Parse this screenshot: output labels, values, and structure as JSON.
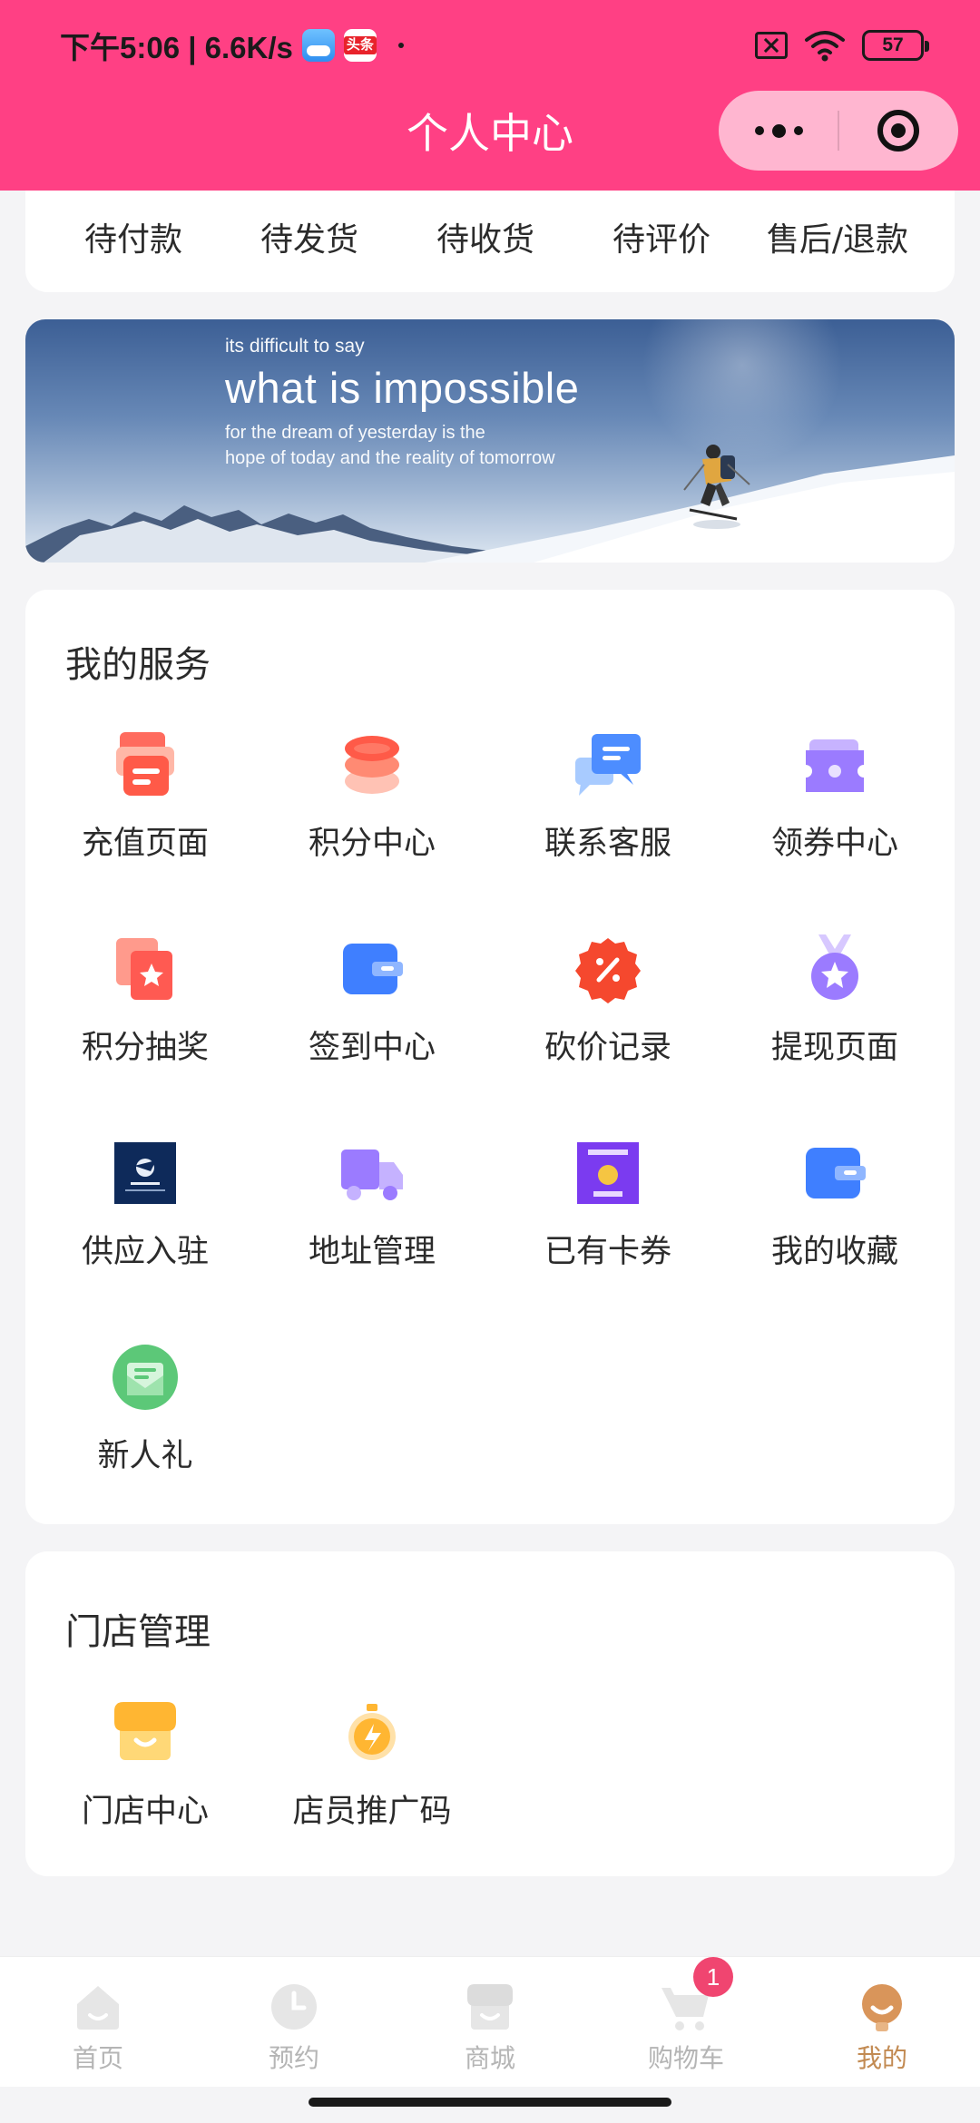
{
  "status_bar": {
    "time_speed": "下午5:06 | 6.6K/s",
    "news_badge": "头条",
    "battery": "57"
  },
  "nav": {
    "title": "个人中心"
  },
  "orders": {
    "items": [
      "待付款",
      "待发货",
      "待收货",
      "待评价",
      "售后/退款"
    ]
  },
  "banner": {
    "small": "its difficult to say",
    "big": "what is impossible",
    "line1": "for the dream of yesterday is the",
    "line2": "hope of today and the reality of tomorrow"
  },
  "services": {
    "title": "我的服务",
    "items": [
      {
        "label": "充值页面",
        "icon": "recharge-icon"
      },
      {
        "label": "积分中心",
        "icon": "points-stack-icon"
      },
      {
        "label": "联系客服",
        "icon": "chat-bubbles-icon"
      },
      {
        "label": "领券中心",
        "icon": "coupon-ticket-icon"
      },
      {
        "label": "积分抽奖",
        "icon": "lottery-star-icon"
      },
      {
        "label": "签到中心",
        "icon": "checkin-wallet-icon"
      },
      {
        "label": "砍价记录",
        "icon": "discount-badge-icon"
      },
      {
        "label": "提现页面",
        "icon": "medal-icon"
      },
      {
        "label": "供应入驻",
        "icon": "supplier-logo-icon"
      },
      {
        "label": "地址管理",
        "icon": "truck-icon"
      },
      {
        "label": "已有卡券",
        "icon": "card-coupon-icon"
      },
      {
        "label": "我的收藏",
        "icon": "favorites-wallet-icon"
      },
      {
        "label": "新人礼",
        "icon": "gift-envelope-icon"
      }
    ]
  },
  "store": {
    "title": "门店管理",
    "items": [
      {
        "label": "门店中心",
        "icon": "store-icon"
      },
      {
        "label": "店员推广码",
        "icon": "promo-stopwatch-icon"
      }
    ]
  },
  "tabbar": {
    "items": [
      "首页",
      "预约",
      "商城",
      "购物车",
      "我的"
    ],
    "cart_badge": "1",
    "active": "我的"
  },
  "colors": {
    "header": "#ff4084",
    "active_tab": "#c28a52",
    "badge": "#f04570"
  }
}
